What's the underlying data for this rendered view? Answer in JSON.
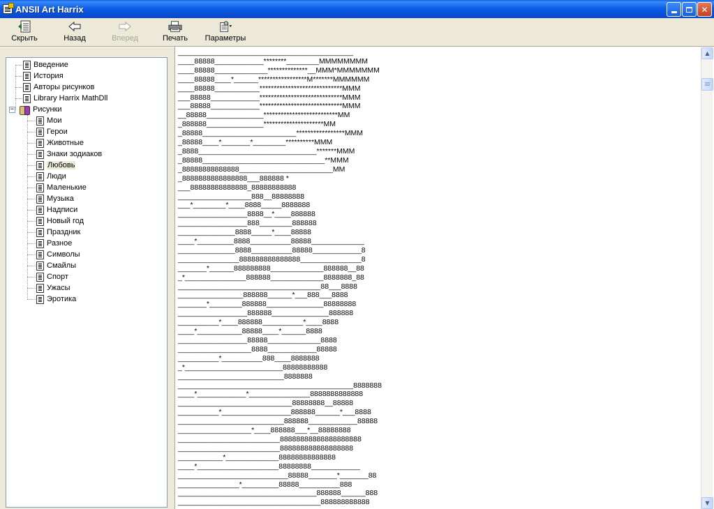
{
  "window": {
    "title": "ANSII Art Harrix"
  },
  "toolbar": {
    "hide_label": "Скрыть",
    "back_label": "Назад",
    "forward_label": "Вперед",
    "print_label": "Печать",
    "options_label": "Параметры"
  },
  "nav": {
    "root_items": [
      "Введение",
      "История",
      "Авторы рисунков",
      "Library Harrix MathDll"
    ],
    "folder_label": "Рисунки",
    "folder_expander": "−",
    "children": [
      "Мои",
      "Герои",
      "Животные",
      "Знаки зодиаков",
      "Любовь",
      "Люди",
      "Маленькие",
      "Музыка",
      "Надписи",
      "Новый год",
      "Праздник",
      "Разное",
      "Символы",
      "Смайлы",
      "Спорт",
      "Ужасы",
      "Эротика"
    ],
    "selected_child": "Любовь"
  },
  "content": {
    "art": "___________________________________________\n____88888____________********________MMMMMMMM\n____88888_____________**************__MMM*MMMMMMM\n____88888____*______*****************M*******MMMMMM\n____88888___________*****************************MMM\n___88888____________*****************************MMM\n___88888____________*****************************MMM\n__88888______________**************************MM\n_888888______________*********************MM\n_88888_______________________*****************MMM\n_88888____*_______*________**********MMM\n_8888_____________________________*******MMM\n_88888______________________________**MMM\n_88888888888888_______________________MM\n_8888888888888888___888888 *\n___88888888888888_88888888888\n__________________888__88888888\n___*________*____8888_____8888888\n_________________8888__*____888888\n_________________888________888888\n______________8888_____*____88888\n____*_________8888__________88888_____________\n______________8888__________88888____________8\n_______________888888888888888_______________8\n_______*______888888888_____________888888__88\n_*_______________888888_____________8888888_88\n___________________________________88___8888\n________________888888______*___888___8888\n_______*________888888______________88888888\n_________________888888______________888888\n__________*____888888__________*____8888\n____*___________88888____*______8888\n_________________88888_____________8888\n__________________8888____________88888\n__________*__________888____8888888\n_*________________________88888888888\n__________________________8888888\n___________________________________________8888888\n____*____________*_______________8888888888888\n____________________________88888888__88888\n__________*_________________888888______*___8888\n__________________________888888____________88888\n__________________*____888888___*__88888888\n_________________________88888888888888888888\n_________________________888888888888888888\n___________*_____________88888888888888\n____*____________________88888888____________\n___________________________88888_______*_______88\n_______________*_________88888__________888\n__________________________________888888______888\n___________________________________888888888888\n________________________________________________"
  },
  "scrollbar": {
    "up_glyph": "▲",
    "down_glyph": "▼"
  },
  "colors": {
    "titlebar": "#0a4fd6",
    "window_bg": "#ece9d8",
    "selected_bg": "#ece9d8"
  }
}
